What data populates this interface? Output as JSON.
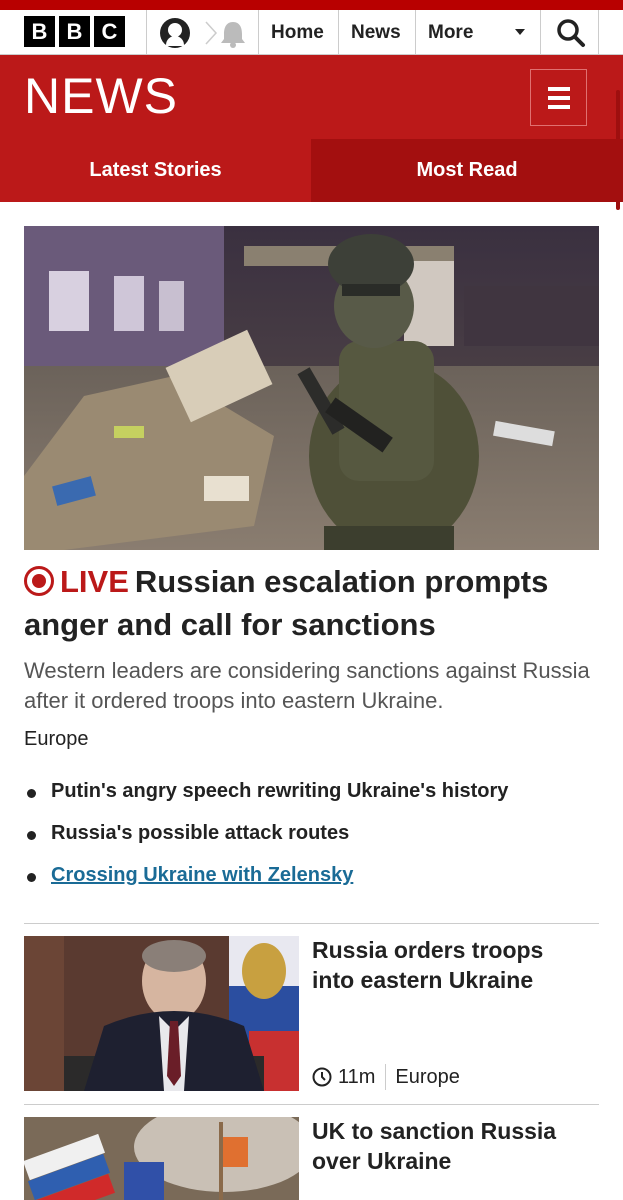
{
  "topbar": {
    "logo_letters": [
      "B",
      "B",
      "C"
    ],
    "icons": [
      "account-icon",
      "chevron-right-icon",
      "bell-icon",
      "search-icon"
    ],
    "nav": [
      {
        "label": "Home"
      },
      {
        "label": "News"
      },
      {
        "label": "More"
      }
    ]
  },
  "header": {
    "title": "NEWS",
    "menu_icon": "hamburger-menu-icon",
    "tabs": [
      {
        "label": "Latest Stories"
      },
      {
        "label": "Most Read"
      }
    ]
  },
  "colors": {
    "brand_red": "#bb1919",
    "active_tab": "#a30f0f",
    "link": "#1a6b96"
  },
  "lead_story": {
    "live_label": "LIVE",
    "headline": "Russian escalation prompts anger and call for sanctions",
    "summary": "Western leaders are considering sanctions against Russia after it ordered troops into eastern Ukraine.",
    "tag": "Europe",
    "related": [
      {
        "label": "Putin's angry speech rewriting Ukraine's history"
      },
      {
        "label": "Russia's possible attack routes"
      },
      {
        "label": "Crossing Ukraine with Zelensky"
      }
    ]
  },
  "stories": [
    {
      "title": "Russia orders troops into eastern Ukraine",
      "time": "11m",
      "tag": "Europe"
    },
    {
      "title": "UK to sanction Russia over Ukraine"
    }
  ]
}
